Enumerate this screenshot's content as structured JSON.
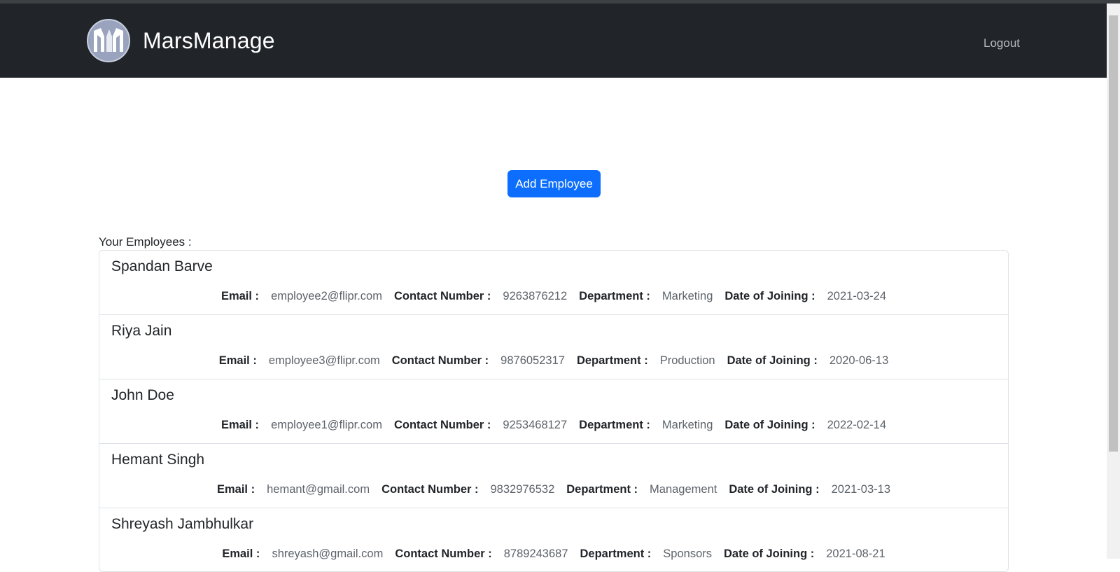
{
  "navbar": {
    "brand_name": "MarsManage",
    "logout_label": "Logout",
    "logo_icon": "mm-logo-icon",
    "background": "#212529"
  },
  "actions": {
    "add_employee_label": "Add Employee",
    "button_color": "#0d6efd"
  },
  "employees_section": {
    "label": "Your Employees :",
    "field_labels": {
      "email": "Email :",
      "contact": "Contact Number :",
      "department": "Department :",
      "doj": "Date of Joining :"
    },
    "employees": [
      {
        "name": "Spandan Barve",
        "email": "employee2@flipr.com",
        "contact": "9263876212",
        "department": "Marketing",
        "doj": "2021-03-24"
      },
      {
        "name": "Riya Jain",
        "email": "employee3@flipr.com",
        "contact": "9876052317",
        "department": "Production",
        "doj": "2020-06-13"
      },
      {
        "name": "John Doe",
        "email": "employee1@flipr.com",
        "contact": "9253468127",
        "department": "Marketing",
        "doj": "2022-02-14"
      },
      {
        "name": "Hemant Singh",
        "email": "hemant@gmail.com",
        "contact": "9832976532",
        "department": "Management",
        "doj": "2021-03-13"
      },
      {
        "name": "Shreyash Jambhulkar",
        "email": "shreyash@gmail.com",
        "contact": "8789243687",
        "department": "Sponsors",
        "doj": "2021-08-21"
      }
    ]
  }
}
